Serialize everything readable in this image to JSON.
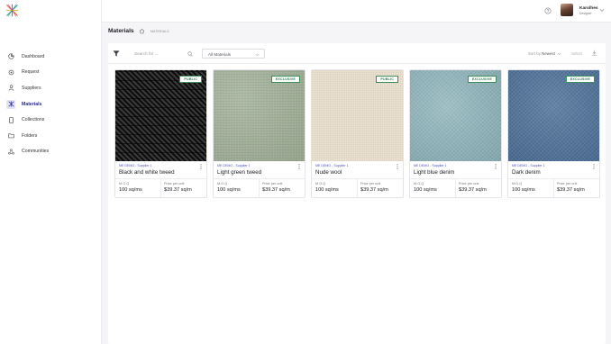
{
  "sidebar": {
    "items": [
      {
        "label": "Dashboard",
        "icon": "dashboard-icon"
      },
      {
        "label": "Request",
        "icon": "request-icon"
      },
      {
        "label": "Suppliers",
        "icon": "suppliers-icon"
      },
      {
        "label": "Materials",
        "icon": "materials-icon",
        "active": true
      },
      {
        "label": "Collections",
        "icon": "collections-icon"
      },
      {
        "label": "Folders",
        "icon": "folders-icon"
      },
      {
        "label": "Communities",
        "icon": "communities-icon"
      }
    ]
  },
  "user": {
    "name": "Karolhes",
    "role": "Designer"
  },
  "header": {
    "title": "Materials",
    "crumb": "MATERIALS"
  },
  "toolbar": {
    "search_placeholder": "Search for ...",
    "filter_value": "All Materials",
    "sort_prefix": "Sort by",
    "sort_value": "Newest",
    "select_label": "Select"
  },
  "labels": {
    "moq": "M.O.Q",
    "price": "Price per unit"
  },
  "cards": [
    {
      "tag": "PUBLIC",
      "supplier": "ME DEMO - Supplier 1",
      "name": "Black and white tweed",
      "moq": "100 sq/ms",
      "price": "$39.37 sq/m",
      "swatch": "tweed"
    },
    {
      "tag": "EXCLUSIVE",
      "supplier": "ME DEMO - Supplier 1",
      "name": "Light green tweed",
      "moq": "100 sq/ms",
      "price": "$39.37 sq/m",
      "swatch": "green"
    },
    {
      "tag": "PUBLIC",
      "supplier": "ME DEMO - Supplier 1",
      "name": "Nude wool",
      "moq": "100 sq/ms",
      "price": "$39.37 sq/m",
      "swatch": "nude"
    },
    {
      "tag": "EXCLUSIVE",
      "supplier": "ME DEMO - Supplier 1",
      "name": "Light blue denim",
      "moq": "100 sq/ms",
      "price": "$39.37 sq/m",
      "swatch": "lightblue"
    },
    {
      "tag": "EXCLUSIVE",
      "supplier": "ME DEMO - Supplier 1",
      "name": "Dark denim",
      "moq": "100 sq/ms",
      "price": "$39.37 sq/m",
      "swatch": "darkblue"
    }
  ],
  "colors": {
    "accent": "#2b2c8f",
    "tag_green": "#2f7a4b",
    "supplier_link": "#4b4fc1"
  }
}
